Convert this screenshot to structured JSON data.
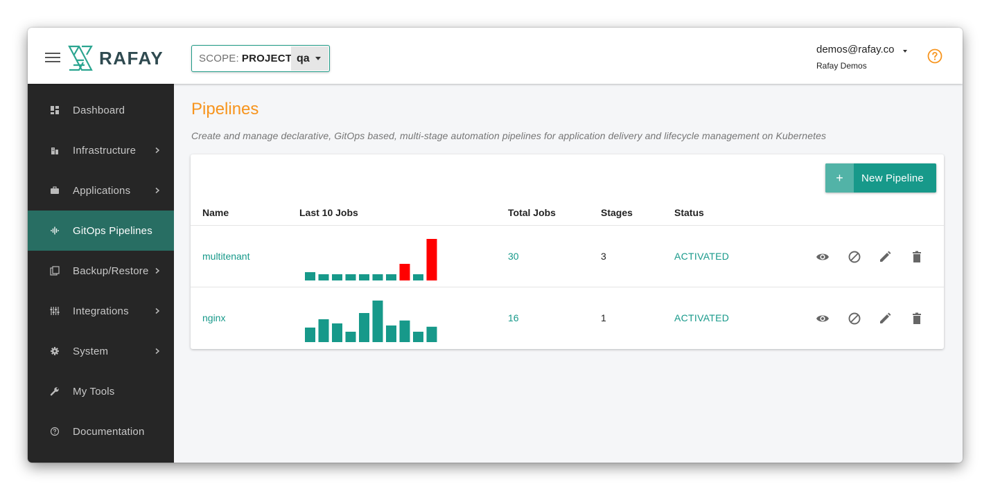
{
  "header": {
    "brand": "RAFAY",
    "scope": {
      "label": "SCOPE:",
      "value": "PROJECT",
      "selected": "qa"
    },
    "user": {
      "email": "demos@rafay.co",
      "org": "Rafay Demos"
    }
  },
  "sidebar": {
    "items": [
      {
        "label": "Dashboard",
        "icon": "dashboard-icon",
        "chevron": false,
        "active": false
      },
      {
        "label": "Infrastructure",
        "icon": "building-icon",
        "chevron": true,
        "active": false
      },
      {
        "label": "Applications",
        "icon": "briefcase-icon",
        "chevron": true,
        "active": false
      },
      {
        "label": "GitOps Pipelines",
        "icon": "waveform-icon",
        "chevron": false,
        "active": true
      },
      {
        "label": "Backup/Restore",
        "icon": "copy-icon",
        "chevron": true,
        "active": false
      },
      {
        "label": "Integrations",
        "icon": "sliders-icon",
        "chevron": true,
        "active": false
      },
      {
        "label": "System",
        "icon": "gear-icon",
        "chevron": true,
        "active": false
      },
      {
        "label": "My Tools",
        "icon": "wrench-icon",
        "chevron": false,
        "active": false
      },
      {
        "label": "Documentation",
        "icon": "help-circle-icon",
        "chevron": false,
        "active": false
      }
    ]
  },
  "page": {
    "title": "Pipelines",
    "description": "Create and manage declarative, GitOps based, multi-stage automation pipelines for application delivery and lifecycle management on Kubernetes",
    "new_button": "New Pipeline"
  },
  "table": {
    "columns": [
      "Name",
      "Last 10 Jobs",
      "Total Jobs",
      "Stages",
      "Status"
    ],
    "rows": [
      {
        "name": "multitenant",
        "total_jobs": "30",
        "stages": "3",
        "status": "ACTIVATED",
        "jobs": [
          {
            "v": 2,
            "s": "ok"
          },
          {
            "v": 1.5,
            "s": "ok"
          },
          {
            "v": 1.5,
            "s": "ok"
          },
          {
            "v": 1.5,
            "s": "ok"
          },
          {
            "v": 1.5,
            "s": "ok"
          },
          {
            "v": 1.5,
            "s": "ok"
          },
          {
            "v": 1.5,
            "s": "ok"
          },
          {
            "v": 4,
            "s": "fail"
          },
          {
            "v": 1.5,
            "s": "ok"
          },
          {
            "v": 10,
            "s": "fail"
          }
        ]
      },
      {
        "name": "nginx",
        "total_jobs": "16",
        "stages": "1",
        "status": "ACTIVATED",
        "jobs": [
          {
            "v": 3.5,
            "s": "ok"
          },
          {
            "v": 5.5,
            "s": "ok"
          },
          {
            "v": 4.5,
            "s": "ok"
          },
          {
            "v": 2.5,
            "s": "ok"
          },
          {
            "v": 7,
            "s": "ok"
          },
          {
            "v": 10,
            "s": "ok"
          },
          {
            "v": 4,
            "s": "ok"
          },
          {
            "v": 5.2,
            "s": "ok"
          },
          {
            "v": 2.5,
            "s": "ok"
          },
          {
            "v": 3.7,
            "s": "ok"
          }
        ]
      }
    ]
  },
  "colors": {
    "accent": "#17998a",
    "title": "#f7941d",
    "ok": "#17998a",
    "fail": "#ff0000",
    "sidebar": "#262626",
    "active": "#286e63"
  }
}
